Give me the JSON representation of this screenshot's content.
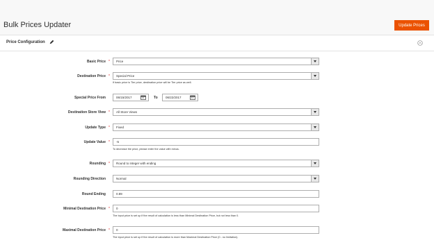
{
  "header": {
    "title": "Bulk Prices Updater",
    "update_button": "Update Prices"
  },
  "section": {
    "title": "Price Configuration",
    "edit_icon": "pencil-icon",
    "collapse_icon": "collapse-circle-icon"
  },
  "fields": {
    "basic_price": {
      "label": "Basic Price",
      "required": "*",
      "value": "Price"
    },
    "destination_price": {
      "label": "Destination Price",
      "required": "*",
      "value": "Special Price",
      "note": "If basic price is Tier price, destination price will be Tier price as well."
    },
    "special_price_from": {
      "label": "Special Price From",
      "from": "06/15/2017",
      "to_label": "To",
      "to": "06/22/2017"
    },
    "destination_store_view": {
      "label": "Destination Store View",
      "required": "*",
      "value": "All Store Views"
    },
    "update_type": {
      "label": "Update Type",
      "required": "*",
      "value": "Fixed"
    },
    "update_value": {
      "label": "Update Value",
      "required": "*",
      "value": "-5",
      "note": "To decrease the price, please enter the value with minus."
    },
    "rounding": {
      "label": "Rounding",
      "required": "*",
      "value": "Round to integer with ending"
    },
    "rounding_direction": {
      "label": "Rounding Direction",
      "value": "Normal"
    },
    "round_ending": {
      "label": "Round Ending",
      "value": "0.89"
    },
    "minimal_destination_price": {
      "label": "Minimal Destination Price",
      "required": "*",
      "value": "0",
      "note": "The input price is set up if the result of calculation is less than Minimal Destination Price, but not less than 0."
    },
    "maximal_destination_price": {
      "label": "Maximal Destination Price",
      "required": "*",
      "value": "0",
      "note": "The input price is set up if the result of calculation is more than Maximal Destination Price (0 - no limitation)."
    }
  },
  "colors": {
    "accent": "#eb5202",
    "required": "#e22626"
  }
}
